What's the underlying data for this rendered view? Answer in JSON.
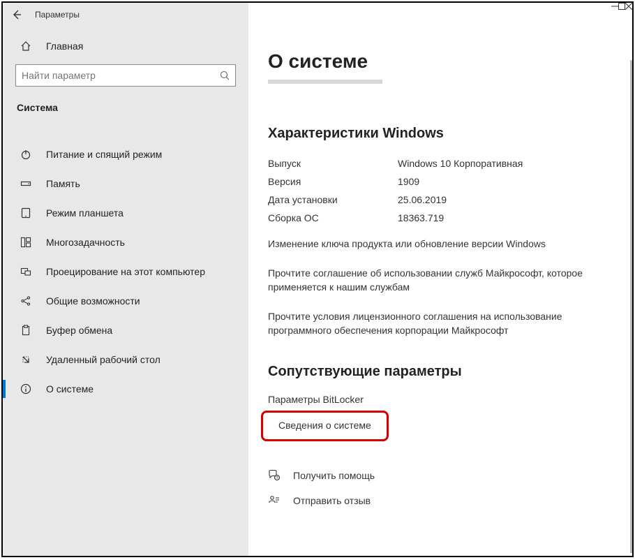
{
  "titlebar": {
    "title": "Параметры"
  },
  "sidebar": {
    "home_label": "Главная",
    "search_placeholder": "Найти параметр",
    "section_label": "Система",
    "items": [
      {
        "label": "Питание и спящий режим",
        "icon": "power-icon"
      },
      {
        "label": "Память",
        "icon": "storage-icon"
      },
      {
        "label": "Режим планшета",
        "icon": "tablet-icon"
      },
      {
        "label": "Многозадачность",
        "icon": "multitask-icon"
      },
      {
        "label": "Проецирование на этот компьютер",
        "icon": "project-icon"
      },
      {
        "label": "Общие возможности",
        "icon": "shared-icon"
      },
      {
        "label": "Буфер обмена",
        "icon": "clipboard-icon"
      },
      {
        "label": "Удаленный рабочий стол",
        "icon": "remote-icon"
      },
      {
        "label": "О системе",
        "icon": "info-icon"
      }
    ],
    "selected_index": 8
  },
  "page": {
    "title": "О системе",
    "windows_specs_heading": "Характеристики Windows",
    "specs": [
      {
        "key": "Выпуск",
        "value": "Windows 10 Корпоративная"
      },
      {
        "key": "Версия",
        "value": "1909"
      },
      {
        "key": "Дата установки",
        "value": "25.06.2019"
      },
      {
        "key": "Сборка ОС",
        "value": "18363.719"
      }
    ],
    "link1": "Изменение ключа продукта или обновление версии Windows",
    "link2": "Прочтите соглашение об использовании служб Майкрософт, которое применяется к нашим службам",
    "link3": "Прочтите условия лицензионного соглашения на использование программного обеспечения корпорации Майкрософт",
    "related_heading": "Сопутствующие параметры",
    "related_links": [
      "Параметры BitLocker",
      "Сведения о системе"
    ],
    "help_label": "Получить помощь",
    "feedback_label": "Отправить отзыв"
  }
}
